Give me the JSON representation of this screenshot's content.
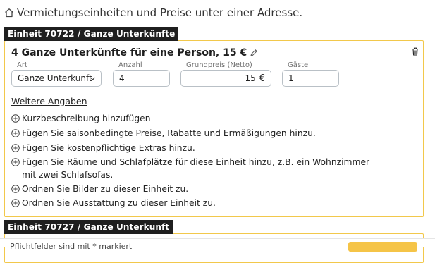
{
  "header": {
    "text": "Vermietungseinheiten und Preise unter einer Adresse."
  },
  "unit1": {
    "tag": "Einheit 70722 / Ganze Unterkünfte",
    "title": "4 Ganze Unterkünfte für eine Person, 15 €",
    "fields": {
      "art_label": "Art",
      "art_value": "Ganze Unterkunft",
      "anzahl_label": "Anzahl",
      "anzahl_value": "4",
      "preis_label": "Grundpreis (Netto)",
      "preis_value": "15",
      "preis_unit": "€",
      "gaeste_label": "Gäste",
      "gaeste_value": "1"
    },
    "more_title": "Weitere Angaben",
    "options": [
      "Kurzbeschreibung hinzufügen",
      "Fügen Sie saisonbedingte Preise, Rabatte und Ermäßigungen hinzu.",
      "Fügen Sie kostenpflichtige Extras hinzu.",
      "Fügen Sie Räume und Schlafplätze für diese Einheit hinzu, z.B. ein Wohnzimmer mit zwei Schlafsofas.",
      "Ordnen Sie Bilder zu dieser Einheit zu.",
      "Ordnen Sie Ausstattung zu dieser Einheit zu."
    ]
  },
  "unit2": {
    "tag": "Einheit 70727 / Ganze Unterkunft"
  },
  "footer": {
    "text": "Pflichtfelder sind mit * markiert"
  }
}
